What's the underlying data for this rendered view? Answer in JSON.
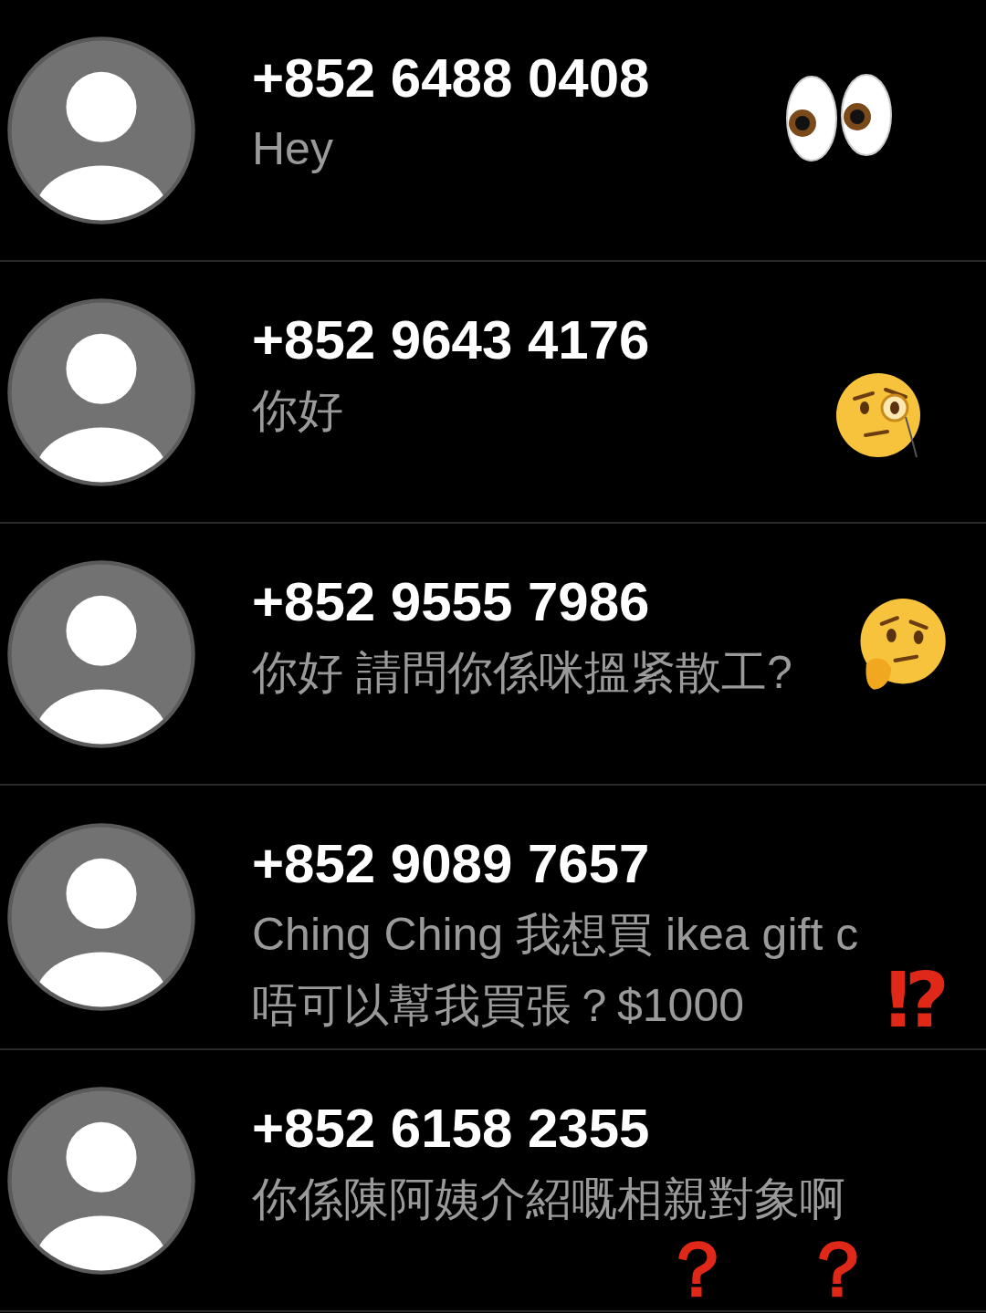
{
  "conversations": [
    {
      "number": "+852 6488 0408",
      "preview": [
        "Hey"
      ],
      "sticker": {
        "kind": "eyes"
      }
    },
    {
      "number": "+852 9643 4176",
      "preview": [
        "你好"
      ],
      "sticker": {
        "kind": "monocle"
      }
    },
    {
      "number": "+852 9555 7986",
      "preview": [
        "你好 請問你係咪搵紧散工?"
      ],
      "sticker": {
        "kind": "thinking"
      }
    },
    {
      "number": "+852 9089 7657",
      "preview": [
        "Ching Ching 我想買 ikea gift c",
        "唔可以幫我買張？$1000"
      ],
      "sticker": {
        "kind": "marks",
        "text": [
          "⁉"
        ]
      }
    },
    {
      "number": "+852 6158 2355",
      "preview": [
        "你係陳阿姨介紹嘅相親對象啊"
      ],
      "sticker": {
        "kind": "marks",
        "text": [
          "？",
          "？"
        ]
      }
    }
  ]
}
